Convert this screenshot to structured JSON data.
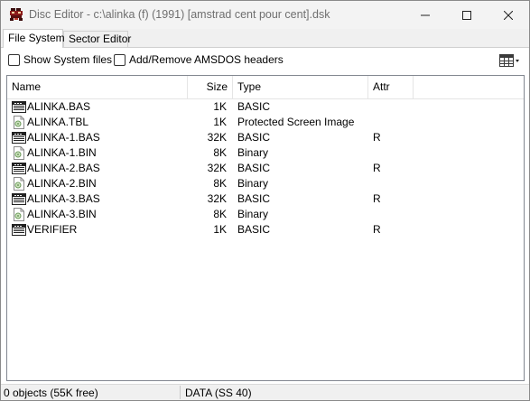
{
  "window": {
    "title": "Disc Editor - c:\\alinka (f) (1991) [amstrad cent pour cent].dsk",
    "app_icon": "amstrad-app-icon",
    "controls": [
      "minimize-icon",
      "maximize-icon",
      "close-icon"
    ]
  },
  "tabs": [
    {
      "label": "File System",
      "active": true
    },
    {
      "label": "Sector Editor",
      "active": false
    }
  ],
  "options": {
    "show_system_files": {
      "label": "Show System files",
      "checked": false
    },
    "amsdos_headers": {
      "label": "Add/Remove AMSDOS headers",
      "checked": false
    },
    "view_button_icon": "view-mode-grid-icon"
  },
  "columns": {
    "name": "Name",
    "size": "Size",
    "type": "Type",
    "attr": "Attr"
  },
  "files": [
    {
      "name": "ALINKA.BAS",
      "size": "1K",
      "type": "BASIC",
      "attr": "",
      "icon": "basic-program-icon"
    },
    {
      "name": "ALINKA.TBL",
      "size": "1K",
      "type": "Protected Screen Image",
      "attr": "",
      "icon": "binary-file-icon"
    },
    {
      "name": "ALINKA-1.BAS",
      "size": "32K",
      "type": "BASIC",
      "attr": "R",
      "icon": "basic-program-icon"
    },
    {
      "name": "ALINKA-1.BIN",
      "size": "8K",
      "type": "Binary",
      "attr": "",
      "icon": "binary-file-icon"
    },
    {
      "name": "ALINKA-2.BAS",
      "size": "32K",
      "type": "BASIC",
      "attr": "R",
      "icon": "basic-program-icon"
    },
    {
      "name": "ALINKA-2.BIN",
      "size": "8K",
      "type": "Binary",
      "attr": "",
      "icon": "binary-file-icon"
    },
    {
      "name": "ALINKA-3.BAS",
      "size": "32K",
      "type": "BASIC",
      "attr": "R",
      "icon": "basic-program-icon"
    },
    {
      "name": "ALINKA-3.BIN",
      "size": "8K",
      "type": "Binary",
      "attr": "",
      "icon": "binary-file-icon"
    },
    {
      "name": "VERIFIER",
      "size": "1K",
      "type": "BASIC",
      "attr": "R",
      "icon": "basic-program-icon"
    }
  ],
  "status": {
    "objects": "0 objects (55K free)",
    "format": "DATA (SS 40)"
  }
}
